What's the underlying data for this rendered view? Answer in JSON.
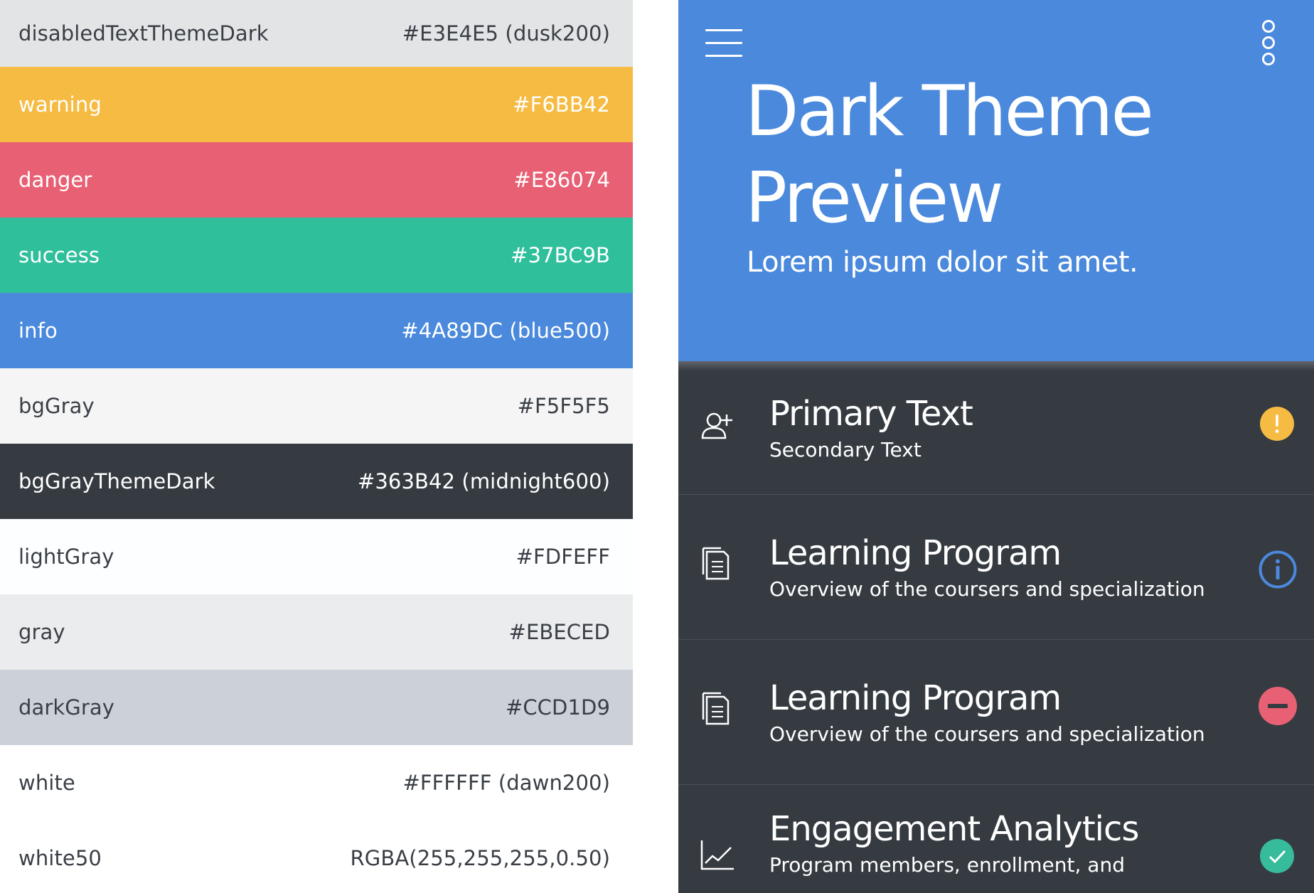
{
  "swatches": [
    {
      "name": "disabledTextThemeDark",
      "value": "#E3E4E5 (dusk200)"
    },
    {
      "name": "warning",
      "value": "#F6BB42"
    },
    {
      "name": "danger",
      "value": "#E86074"
    },
    {
      "name": "success",
      "value": "#37BC9B"
    },
    {
      "name": "info",
      "value": "#4A89DC (blue500)"
    },
    {
      "name": "bgGray",
      "value": "#F5F5F5"
    },
    {
      "name": "bgGrayThemeDark",
      "value": "#363B42 (midnight600)"
    },
    {
      "name": "lightGray",
      "value": "#FDFEFF"
    },
    {
      "name": "gray",
      "value": "#EBECED"
    },
    {
      "name": "darkGray",
      "value": "#CCD1D9"
    },
    {
      "name": "white",
      "value": "#FFFFFF (dawn200)"
    },
    {
      "name": "white50",
      "value": "RGBA(255,255,255,0.50)"
    }
  ],
  "preview": {
    "title": "Dark Theme Preview",
    "subtitle": "Lorem ipsum dolor sit amet.",
    "menu_icon": "hamburger-menu-icon",
    "more_icon": "more-vertical-icon",
    "items": [
      {
        "title": "Primary Text",
        "subtitle": "Secondary Text",
        "icon": "add-user-icon",
        "status_icon": "warning-icon",
        "status_color": "#F6BB42"
      },
      {
        "title": "Learning Program",
        "subtitle": "Overview of the coursers and specialization",
        "icon": "document-icon",
        "status_icon": "info-icon",
        "status_color": "#4A89DC"
      },
      {
        "title": "Learning Program",
        "subtitle": "Overview of the coursers and specialization",
        "icon": "document-icon",
        "status_icon": "danger-icon",
        "status_color": "#E86074"
      },
      {
        "title": "Engagement Analytics",
        "subtitle": "Program members, enrollment, and",
        "icon": "line-chart-icon",
        "status_icon": "success-icon",
        "status_color": "#37BC9B"
      }
    ]
  },
  "colors": {
    "bgGrayThemeDark": "#363B42",
    "info": "#4A89DC",
    "warning": "#F6BB42",
    "danger": "#E86074",
    "success": "#37BC9B"
  }
}
